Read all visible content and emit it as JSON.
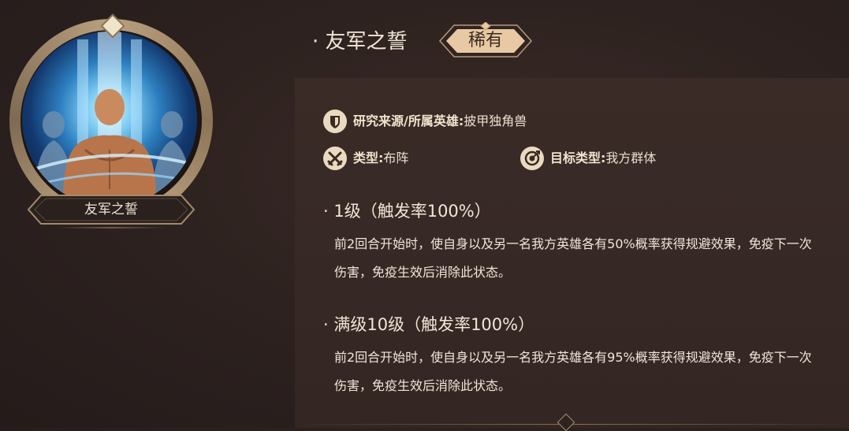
{
  "skill": {
    "name": "友军之誓",
    "title": "· 友军之誓",
    "rarity": "稀有"
  },
  "portrait": {
    "nameplate": "友军之誓",
    "glow_color": "#7ccaf1"
  },
  "info": {
    "source_label": "研究来源/所属英雄:",
    "source_value": "披甲独角兽",
    "type_label": "类型:",
    "type_value": "布阵",
    "target_label": "目标类型:",
    "target_value": "我方群体"
  },
  "icons": [
    "shield-icon",
    "crossed-swords-icon",
    "target-icon"
  ],
  "levels": [
    {
      "title": "· 1级（触发率100%）",
      "description": "前2回合开始时，使自身以及另一名我方英雄各有50%概率获得规避效果，免疫下一次伤害，免疫生效后消除此状态。"
    },
    {
      "title": "· 满级10级（触发率100%）",
      "description": "前2回合开始时，使自身以及另一名我方英雄各有95%概率获得规避效果，免疫下一次伤害，免疫生效后消除此状态。"
    }
  ],
  "colors": {
    "background": "#2c211f",
    "panel": "#342724",
    "gold": "#b9a07f",
    "rarity_badge": "#e9c9a3"
  }
}
